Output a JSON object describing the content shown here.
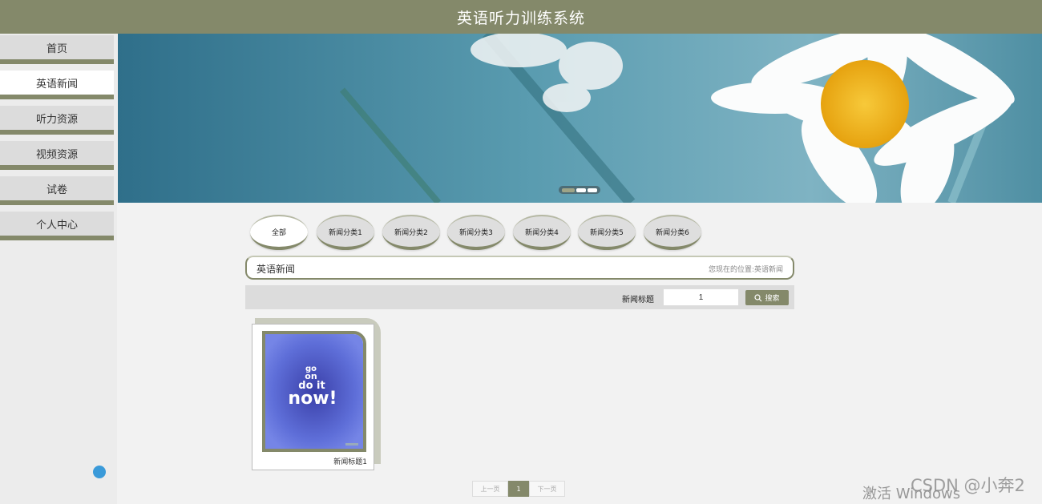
{
  "header": {
    "title": "英语听力训练系统"
  },
  "sidebar": {
    "items": [
      {
        "label": "首页"
      },
      {
        "label": "英语新闻",
        "active": true
      },
      {
        "label": "听力资源"
      },
      {
        "label": "视频资源"
      },
      {
        "label": "试卷"
      },
      {
        "label": "个人中心"
      }
    ]
  },
  "categories": [
    {
      "label": "全部",
      "active": true
    },
    {
      "label": "新闻分类1"
    },
    {
      "label": "新闻分类2"
    },
    {
      "label": "新闻分类3"
    },
    {
      "label": "新闻分类4"
    },
    {
      "label": "新闻分类5"
    },
    {
      "label": "新闻分类6"
    }
  ],
  "breadcrumb": {
    "title": "英语新闻",
    "location_prefix": "您现在的位置:",
    "location": "英语新闻"
  },
  "search": {
    "label": "新闻标题",
    "value": "1",
    "button_label": "搜索"
  },
  "news": [
    {
      "caption": "新闻标题1",
      "thumb_text": [
        "go",
        "on",
        "do it",
        "now!"
      ]
    }
  ],
  "pagination": {
    "prev": "上一页",
    "current": "1",
    "next": "下一页"
  },
  "overlay": {
    "activate": "激活 Windows",
    "csdn": "CSDN @小奔2"
  },
  "colors": {
    "accent": "#84896a",
    "banner_sky": "#4f8fa3",
    "flower_center": "#f2b81b"
  }
}
